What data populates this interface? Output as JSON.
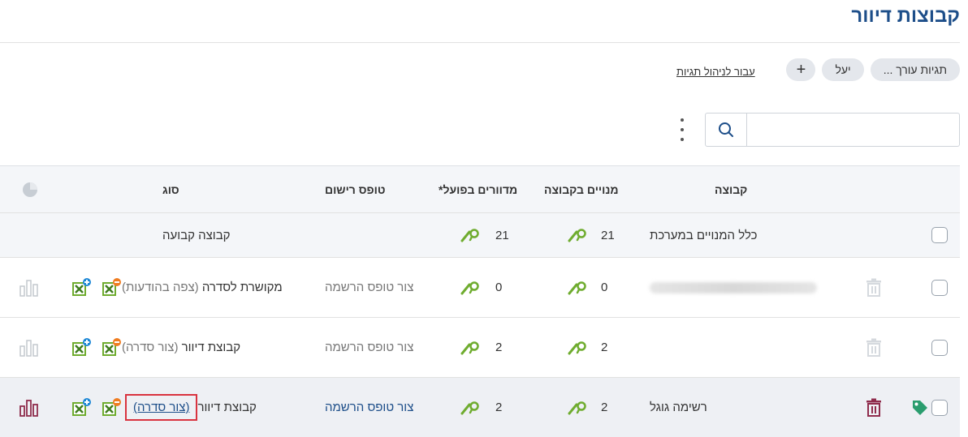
{
  "page": {
    "title": "קבוצות דיוור"
  },
  "tags": {
    "chips": [
      "תגיות עורך ...",
      "יעל"
    ],
    "add_label": "+",
    "manage_link": "עבור לניהול תגיות"
  },
  "search": {
    "placeholder": ""
  },
  "table": {
    "headers": {
      "group": "קבוצה",
      "members": "מנויים בקבוצה",
      "actual": "מדוורים בפועל*",
      "form": "טופס רישום",
      "type": "סוג"
    },
    "rows": [
      {
        "group": "כלל המנויים במערכת",
        "members": "21",
        "actual": "21",
        "form": "",
        "type": "קבוצה קבועה",
        "type_note": ""
      },
      {
        "group": "",
        "members": "0",
        "actual": "0",
        "form": "צור טופס הרשמה",
        "type": "מקושרת לסדרה",
        "type_note": "(צפה בהודעות)"
      },
      {
        "group": "",
        "members": "2",
        "actual": "2",
        "form": "צור טופס הרשמה",
        "type": "קבוצת דיוור",
        "type_note": "(צור סדרה)"
      },
      {
        "group": "רשימה גוגל",
        "members": "2",
        "actual": "2",
        "form": "צור טופס הרשמה",
        "type": "קבוצת דיוור",
        "type_note": "(צור סדרה)"
      }
    ]
  },
  "colors": {
    "accent": "#1d4e89",
    "green": "#6fac2f",
    "orange": "#ef7d22",
    "trash_active": "#8f2c4c",
    "tag": "#2a9d6e",
    "highlight": "#d9333f"
  },
  "icons": [
    "search-icon",
    "kebab-menu-icon",
    "pie-chart-icon",
    "pencil-icon",
    "magnifier-icon",
    "trash-icon",
    "tag-icon",
    "excel-remove-icon",
    "excel-add-icon",
    "bar-chart-icon"
  ]
}
